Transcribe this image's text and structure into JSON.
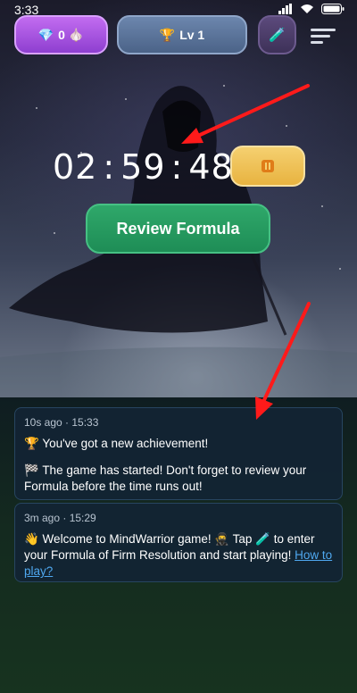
{
  "status_bar": {
    "time": "3:33"
  },
  "top_bar": {
    "gems_count": "0",
    "level_label": "Lv 1"
  },
  "timer": {
    "hours": "02",
    "minutes": "59",
    "seconds": "48",
    "separator": ":"
  },
  "review_button_label": "Review Formula",
  "notifications": [
    {
      "meta": "10s ago · 15:33",
      "lines": [
        "🏆 You've got a new achievement!",
        "🏁 The game has started! Don't forget to review your Formula before the time runs out!"
      ]
    },
    {
      "meta": "3m ago · 15:29",
      "text_before": "👋 Welcome to MindWarrior game! 🥷 Tap 🧪 to enter your Formula of Firm Resolution and start playing! ",
      "link_label": "How to play?"
    }
  ],
  "icons": {
    "gem": "gem-icon",
    "garlic": "garlic-icon",
    "trophy": "trophy-icon",
    "lab": "test-tube-icon",
    "menu": "menu-icon",
    "pause": "pause-icon"
  },
  "colors": {
    "gems_pill": "#b15ee6",
    "level_pill": "#5a749b",
    "pause_button": "#f0c356",
    "review_button": "#27a062",
    "arrow": "#ff1a1a",
    "link": "#4fa8f0"
  }
}
